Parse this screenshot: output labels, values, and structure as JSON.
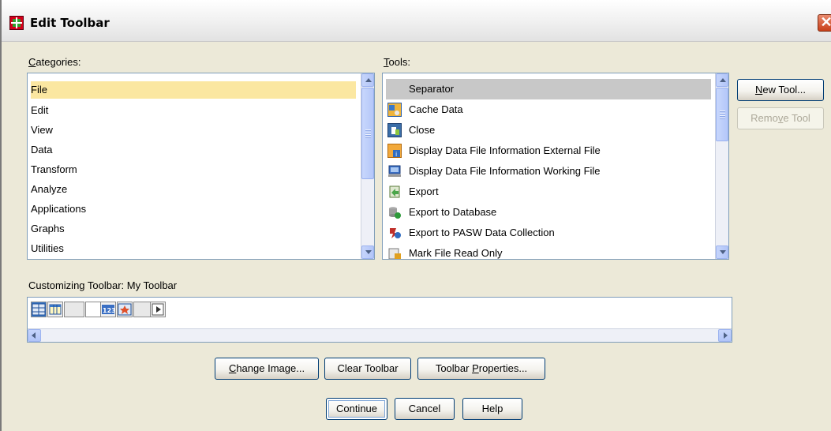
{
  "window": {
    "title": "Edit Toolbar",
    "close_glyph": "✕"
  },
  "categories": {
    "label_prefix": "",
    "label_mnemonic": "C",
    "label_rest": "ategories:",
    "items": [
      "File",
      "Edit",
      "View",
      "Data",
      "Transform",
      "Analyze",
      "Applications",
      "Graphs",
      "Utilities"
    ],
    "selected": "File"
  },
  "tools": {
    "label_prefix": "",
    "label_mnemonic": "T",
    "label_rest": "ools:",
    "items": [
      {
        "label": "Separator",
        "icon": "separator-blank-icon"
      },
      {
        "label": "Cache Data",
        "icon": "cache-data-icon"
      },
      {
        "label": "Close",
        "icon": "close-file-icon"
      },
      {
        "label": "Display Data File Information External File",
        "icon": "data-file-info-external-icon"
      },
      {
        "label": "Display Data File Information Working File",
        "icon": "data-file-info-working-icon"
      },
      {
        "label": "Export",
        "icon": "export-icon"
      },
      {
        "label": "Export to Database",
        "icon": "export-database-icon"
      },
      {
        "label": "Export to PASW Data Collection",
        "icon": "export-pasw-icon"
      },
      {
        "label": "Mark File Read Only",
        "icon": "mark-read-only-icon"
      }
    ],
    "selected": "Separator"
  },
  "buttons": {
    "new_tool": {
      "prefix": "",
      "mnemonic": "N",
      "rest": "ew Tool..."
    },
    "remove_tool": {
      "prefix": "Remo",
      "mnemonic": "v",
      "rest": "e Tool"
    },
    "change_image": {
      "prefix": "",
      "mnemonic": "C",
      "rest": "hange Image..."
    },
    "clear_toolbar": {
      "prefix": "Clear Toolbar",
      "mnemonic": "",
      "rest": ""
    },
    "toolbar_properties": {
      "prefix": "Toolbar ",
      "mnemonic": "P",
      "rest": "roperties..."
    },
    "continue": "Continue",
    "cancel": "Cancel",
    "help": "Help"
  },
  "customizing": {
    "label": "Customizing Toolbar:  My Toolbar",
    "toolbar_buttons": [
      "grid-view-icon",
      "table-icon",
      "blank-icon",
      "number-123-icon",
      "chart-star-icon",
      "blank-icon",
      "play-icon"
    ]
  },
  "colors": {
    "selection": "#fbe7a1",
    "tool_selection": "#c8c8c8",
    "dialog_bg": "#ece9d8",
    "border": "#7f9db9"
  }
}
